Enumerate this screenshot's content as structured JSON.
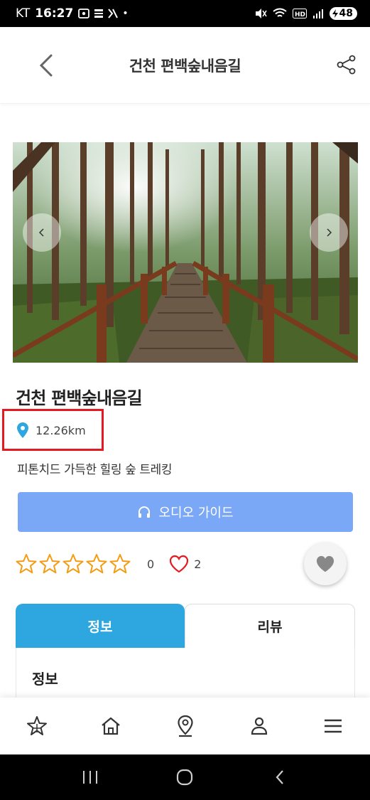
{
  "status_bar": {
    "carrier": "KT",
    "time": "16:27",
    "battery": "48"
  },
  "header": {
    "title": "건천 편백숲내음길"
  },
  "place": {
    "name": "건천 편백숲내음길",
    "distance": "12.26km",
    "description": "피톤치드 가득한 힐링 숲 트레킹"
  },
  "audio_guide": {
    "label": "오디오 가이드"
  },
  "rating": {
    "stars_filled": 0,
    "stars_total": 5,
    "rating_count": "0",
    "like_count": "2"
  },
  "tabs": [
    {
      "label": "정보",
      "active": true
    },
    {
      "label": "리뷰",
      "active": false
    }
  ],
  "info_section": {
    "title": "정보"
  },
  "colors": {
    "accent_blue": "#2ea7e0",
    "audio_button": "#7aa8f7",
    "star_orange": "#f39c12",
    "heart_red": "#e5191f",
    "highlight_red": "#e5191f"
  },
  "icons": {
    "back": "chevron-left-icon",
    "share": "share-icon",
    "pin": "map-pin-icon",
    "audio": "headphones-icon",
    "star": "star-outline-icon",
    "like": "heart-outline-icon",
    "favorite": "heart-filled-icon",
    "nav": [
      "star-logo-icon",
      "home-icon",
      "location-icon",
      "user-icon",
      "menu-icon"
    ]
  }
}
